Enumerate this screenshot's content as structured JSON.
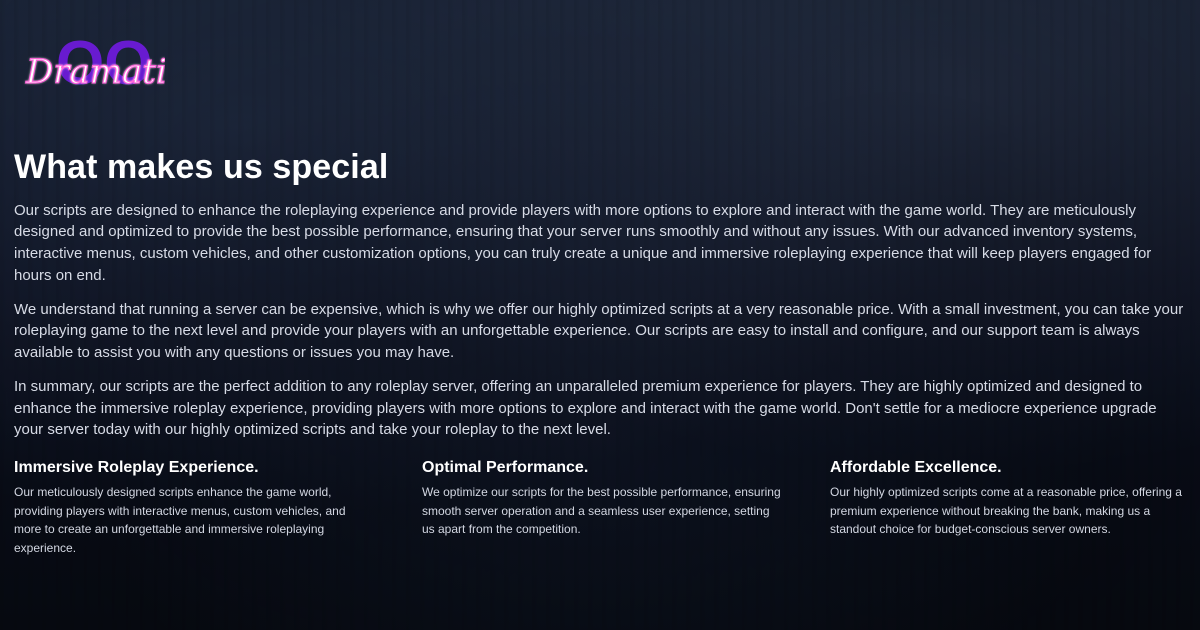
{
  "brand": {
    "script_text": "Dramatic",
    "monogram_text": "OO",
    "colors": {
      "accent_purple": "#6d1bd9",
      "script_pink": "#ff5ad8"
    }
  },
  "header": {
    "title": "What makes us special"
  },
  "content": {
    "paragraphs": [
      "Our scripts are designed to enhance the roleplaying experience and provide players with more options to explore and interact with the game world. They are meticulously designed and optimized to provide the best possible performance, ensuring that your server runs smoothly and without any issues. With our advanced inventory systems, interactive menus, custom vehicles, and other customization options, you can truly create a unique and immersive roleplaying experience that will keep players engaged for hours on end.",
      "We understand that running a server can be expensive, which is why we offer our highly optimized scripts at a very reasonable price. With a small investment, you can take your roleplaying game to the next level and provide your players with an unforgettable experience. Our scripts are easy to install and configure, and our support team is always available to assist you with any questions or issues you may have.",
      "In summary, our scripts are the perfect addition to any roleplay server, offering an unparalleled premium experience for players. They are highly optimized and designed to enhance the immersive roleplay experience, providing players with more options to explore and interact with the game world. Don't settle for a mediocre experience upgrade your server today with our highly optimized scripts and take your roleplay to the next level."
    ]
  },
  "features": [
    {
      "title": "Immersive Roleplay Experience.",
      "text": "Our meticulously designed scripts enhance the game world, providing players with interactive menus, custom vehicles, and more to create an unforgettable and immersive roleplaying experience."
    },
    {
      "title": "Optimal Performance.",
      "text": "We optimize our scripts for the best possible performance, ensuring smooth server operation and a seamless user experience, setting us apart from the competition."
    },
    {
      "title": "Affordable Excellence.",
      "text": "Our highly optimized scripts come at a reasonable price, offering a premium experience without breaking the bank, making us a standout choice for budget-conscious server owners."
    }
  ]
}
